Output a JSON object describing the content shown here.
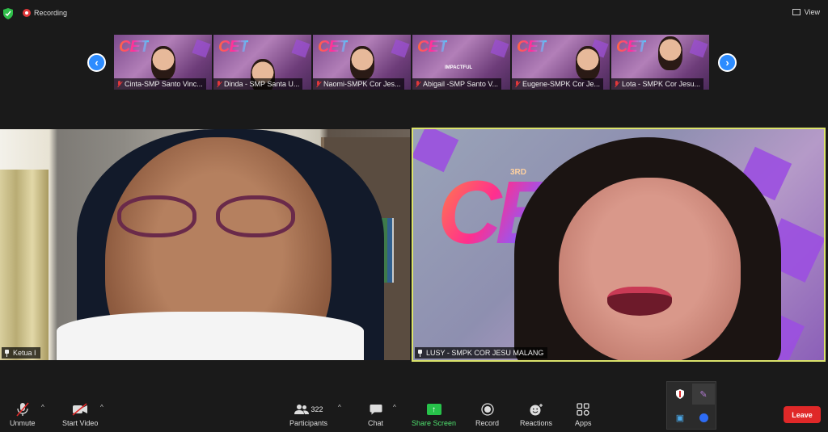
{
  "topbar": {
    "recording_label": "Recording",
    "view_label": "View",
    "icons": [
      "shield-icon",
      "record-icon",
      "view-grid-icon"
    ]
  },
  "gallery": {
    "prev_icon": "chevron-left-icon",
    "next_icon": "chevron-right-icon",
    "participants": [
      {
        "name": "Cinta-SMP Santo Vinc...",
        "muted": true
      },
      {
        "name": "Dinda - SMP Santa U...",
        "muted": true
      },
      {
        "name": "Naomi-SMPK Cor Jes...",
        "muted": true
      },
      {
        "name": "Abigail -SMP Santo V...",
        "muted": true
      },
      {
        "name": "Eugene-SMPK Cor Je...",
        "muted": true
      },
      {
        "name": "Lota - SMPK Cor Jesu...",
        "muted": true
      }
    ],
    "thumb_logo_text": "CET",
    "thumb_subtitle": "IMPACTFUL"
  },
  "main_videos": {
    "left": {
      "name": "Ketua I",
      "pinned": true
    },
    "right": {
      "name": "LUSY - SMPK COR JESU MALANG",
      "pinned": true,
      "active_speaker": true,
      "logo_text": "CET",
      "logo_prefix": "3RD"
    }
  },
  "toolbar": {
    "unmute_label": "Unmute",
    "start_video_label": "Start Video",
    "participants_label": "Participants",
    "participants_count": "322",
    "chat_label": "Chat",
    "share_screen_label": "Share Screen",
    "record_label": "Record",
    "reactions_label": "Reactions",
    "apps_label": "Apps",
    "leave_label": "Leave",
    "icons": {
      "unmute": "mic-muted-icon",
      "start_video": "video-off-icon",
      "participants": "people-icon",
      "chat": "chat-bubble-icon",
      "share_screen": "share-screen-icon",
      "record": "record-icon",
      "reactions": "smiley-icon",
      "apps": "apps-icon"
    }
  },
  "colors": {
    "accent_blue": "#2d8cff",
    "share_green": "#27c24a",
    "leave_red": "#e02828",
    "active_speaker_border": "#dbe36b",
    "muted_red": "#e0383a"
  }
}
